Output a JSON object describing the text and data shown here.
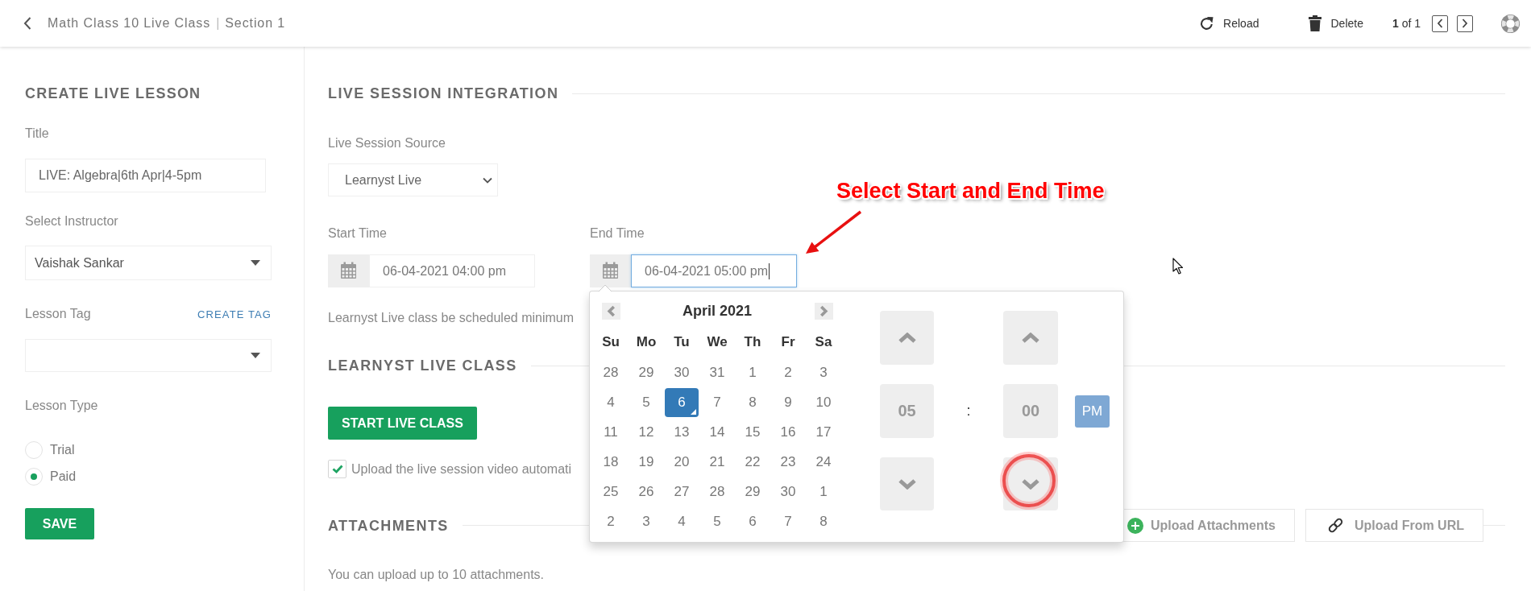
{
  "top_bar": {
    "course": "Math Class 10 Live Class",
    "separator": "|",
    "section": "Section 1",
    "actions": [
      {
        "kind": "reload",
        "label": "Reload"
      },
      {
        "kind": "delete",
        "label": "Delete"
      }
    ],
    "pager": "**1** of 1"
  },
  "sidebar": {
    "heading": "CREATE LIVE LESSON",
    "title_field": {
      "label": "Title",
      "value": "LIVE: Algebra|6th Apr|4-5pm"
    },
    "instructor_field": {
      "label": "Select Instructor",
      "value": "Vaishak Sankar"
    },
    "tag_field": {
      "label": "Lesson Tag",
      "link": "CREATE TAG"
    },
    "lesson_type": {
      "label": "Lesson Type",
      "options": [
        {
          "label": "Trial",
          "selected": false
        },
        {
          "label": "Paid",
          "selected": true
        }
      ]
    },
    "save_button": "SAVE"
  },
  "live_session": {
    "heading": "LIVE SESSION INTEGRATION",
    "source": {
      "label": "Live Session Source",
      "value": "Learnyst Live"
    },
    "times": [
      {
        "label": "Start Time",
        "value": "06-04-2021 04:00 pm",
        "focused": false
      },
      {
        "label": "End Time",
        "value": "06-04-2021 05:00 pm",
        "focused": true
      }
    ],
    "note": "Learnyst Live class be scheduled minimum"
  },
  "live_class": {
    "heading": "LEARNYST LIVE CLASS",
    "button": "START LIVE CLASS",
    "auto_upload": {
      "label": "Upload the live session video automati",
      "checked": true
    }
  },
  "attachments": {
    "heading": "ATTACHMENTS",
    "buttons": [
      {
        "kind": "file",
        "label": "Upload Attachments"
      },
      {
        "kind": "url",
        "label": "Upload From URL"
      }
    ],
    "note": "You can upload up to 10 attachments."
  },
  "datepicker": {
    "month": "April 2021",
    "weekdays": [
      "Su",
      "Mo",
      "Tu",
      "We",
      "Th",
      "Fr",
      "Sa"
    ],
    "weeks": [
      [
        {
          "label": "28",
          "selected": false,
          "today": false
        },
        {
          "label": "29",
          "selected": false,
          "today": false
        },
        {
          "label": "30",
          "selected": false,
          "today": false
        },
        {
          "label": "31",
          "selected": false,
          "today": false
        },
        {
          "label": "1",
          "selected": false,
          "today": false
        },
        {
          "label": "2",
          "selected": false,
          "today": false
        },
        {
          "label": "3",
          "selected": false,
          "today": false
        }
      ],
      [
        {
          "label": "4",
          "selected": false,
          "today": false
        },
        {
          "label": "5",
          "selected": false,
          "today": false
        },
        {
          "label": "6",
          "selected": true,
          "today": true
        },
        {
          "label": "7",
          "selected": false,
          "today": false
        },
        {
          "label": "8",
          "selected": false,
          "today": false
        },
        {
          "label": "9",
          "selected": false,
          "today": false
        },
        {
          "label": "10",
          "selected": false,
          "today": false
        }
      ],
      [
        {
          "label": "11",
          "selected": false,
          "today": false
        },
        {
          "label": "12",
          "selected": false,
          "today": false
        },
        {
          "label": "13",
          "selected": false,
          "today": false
        },
        {
          "label": "14",
          "selected": false,
          "today": false
        },
        {
          "label": "15",
          "selected": false,
          "today": false
        },
        {
          "label": "16",
          "selected": false,
          "today": false
        },
        {
          "label": "17",
          "selected": false,
          "today": false
        }
      ],
      [
        {
          "label": "18",
          "selected": false,
          "today": false
        },
        {
          "label": "19",
          "selected": false,
          "today": false
        },
        {
          "label": "20",
          "selected": false,
          "today": false
        },
        {
          "label": "21",
          "selected": false,
          "today": false
        },
        {
          "label": "22",
          "selected": false,
          "today": false
        },
        {
          "label": "23",
          "selected": false,
          "today": false
        },
        {
          "label": "24",
          "selected": false,
          "today": false
        }
      ],
      [
        {
          "label": "25",
          "selected": false,
          "today": false
        },
        {
          "label": "26",
          "selected": false,
          "today": false
        },
        {
          "label": "27",
          "selected": false,
          "today": false
        },
        {
          "label": "28",
          "selected": false,
          "today": false
        },
        {
          "label": "29",
          "selected": false,
          "today": false
        },
        {
          "label": "30",
          "selected": false,
          "today": false
        },
        {
          "label": "1",
          "selected": false,
          "today": false
        }
      ],
      [
        {
          "label": "2",
          "selected": false,
          "today": false
        },
        {
          "label": "3",
          "selected": false,
          "today": false
        },
        {
          "label": "4",
          "selected": false,
          "today": false
        },
        {
          "label": "5",
          "selected": false,
          "today": false
        },
        {
          "label": "6",
          "selected": false,
          "today": false
        },
        {
          "label": "7",
          "selected": false,
          "today": false
        },
        {
          "label": "8",
          "selected": false,
          "today": false
        }
      ]
    ],
    "hour": "05",
    "separator": ":",
    "minute": "00",
    "period": "PM"
  },
  "annotation": {
    "text": "Select Start and End Time"
  }
}
